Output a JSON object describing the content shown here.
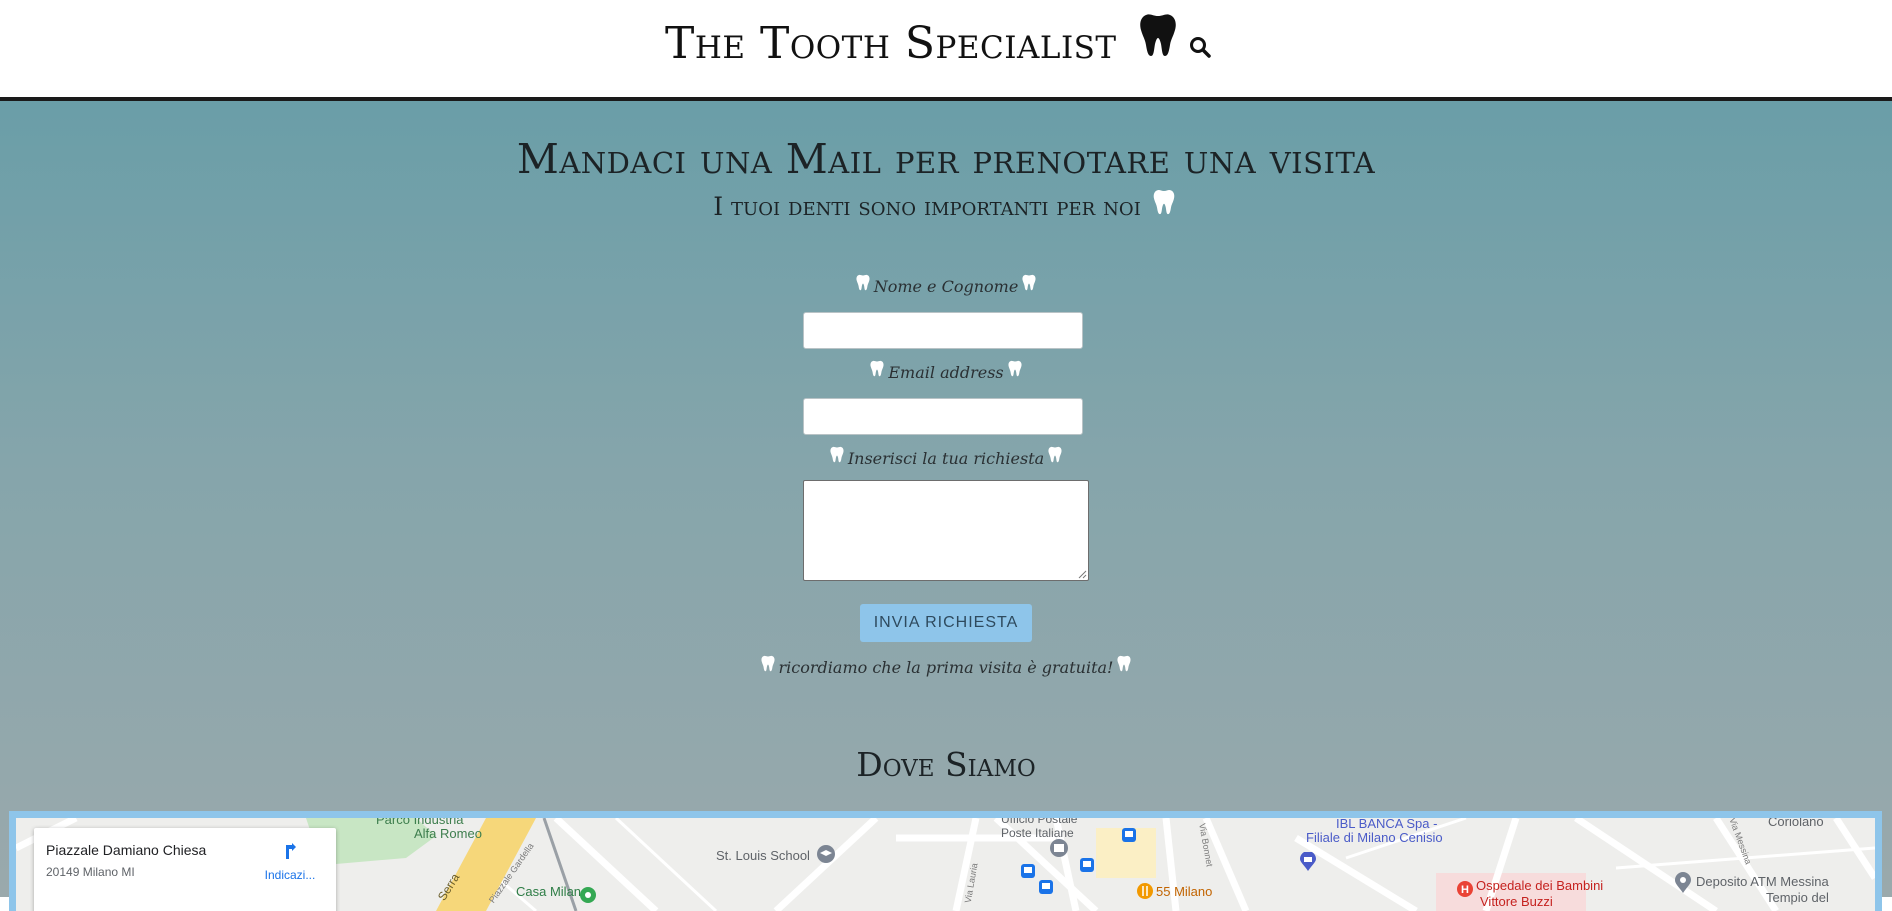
{
  "header": {
    "brand": "The Tooth Specialist",
    "icons": {
      "brand": "tooth-icon",
      "search": "search-icon"
    }
  },
  "contact": {
    "title": "Mandaci una Mail per prenotare una visita",
    "subtitle": "I tuoi denti sono importanti per noi",
    "name_label": "Nome e Cognome",
    "name_value": "",
    "email_label": "Email address",
    "email_value": "",
    "request_label": "Inserisci la tua richiesta",
    "request_value": "",
    "submit_label": "INVIA RICHIESTA",
    "reminder": "ricordiamo che la prima visita è gratuita!"
  },
  "location": {
    "title": "Dove Siamo",
    "card": {
      "place": "Piazzale Damiano Chiesa",
      "address": "20149 Milano MI",
      "directions_label": "Indicazi..."
    },
    "map_labels": {
      "park": "Parco Industria",
      "park2": "Alfa Romeo",
      "street_serra": "Serra",
      "street_gardella": "Piazzale Gardella",
      "school": "St. Louis School",
      "post1": "Ufficio Postale",
      "post2": "Poste Italiane",
      "bank1": "IBL BANCA Spa -",
      "bank2": "Filiale di Milano Cenisio",
      "coriolano": "Coriolano",
      "via_messina": "Via Messina",
      "casa_milan": "Casa Milan",
      "fifty_five": "55 Milano",
      "hospital": "Ospedale dei Bambini",
      "hospital2": "Vittore Buzzi",
      "deposito": "Deposito ATM Messina",
      "tempio": "Tempio del",
      "via_lauria": "Via Lauria",
      "via_bonnet": "Via Bonnet"
    }
  },
  "colors": {
    "accent": "#8ec5ea",
    "gradient_top": "#6a9ea8",
    "gradient_bottom": "#9aa9ac",
    "text_dark": "#1c2326"
  }
}
